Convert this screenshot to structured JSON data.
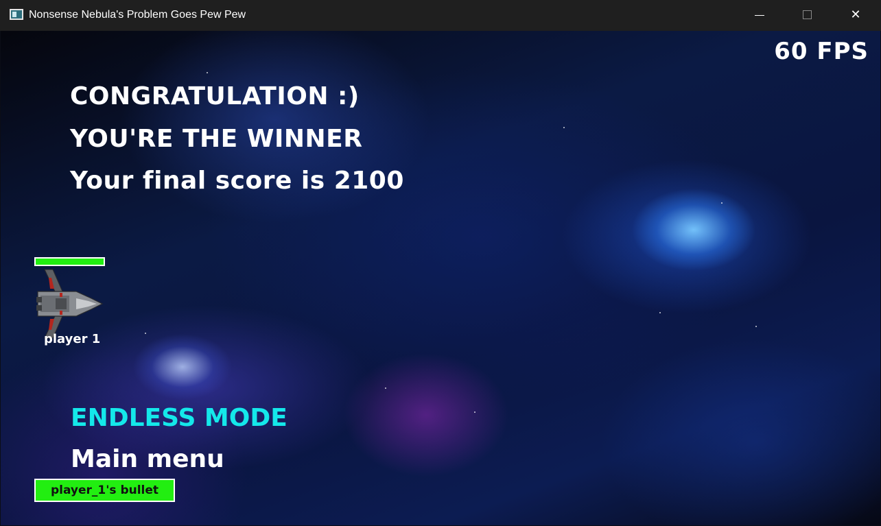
{
  "window": {
    "title": "Nonsense Nebula's Problem Goes Pew Pew",
    "minimize_glyph": "",
    "maximize_glyph": "",
    "close_glyph": "✕"
  },
  "hud": {
    "fps": "60 FPS"
  },
  "messages": {
    "line1": "CONGRATULATION :)",
    "line2": "YOU'RE THE WINNER",
    "line3": "Your final score is 2100"
  },
  "player": {
    "label": "player 1",
    "health_fraction": 1.0,
    "health_color": "#22ee11",
    "icon": "spaceship-icon"
  },
  "menu": {
    "endless_mode": "ENDLESS MODE",
    "main_menu": "Main menu",
    "selected_color": "#14e8ea"
  },
  "bullet": {
    "label": "player_1's bullet",
    "color": "#22ee11"
  }
}
